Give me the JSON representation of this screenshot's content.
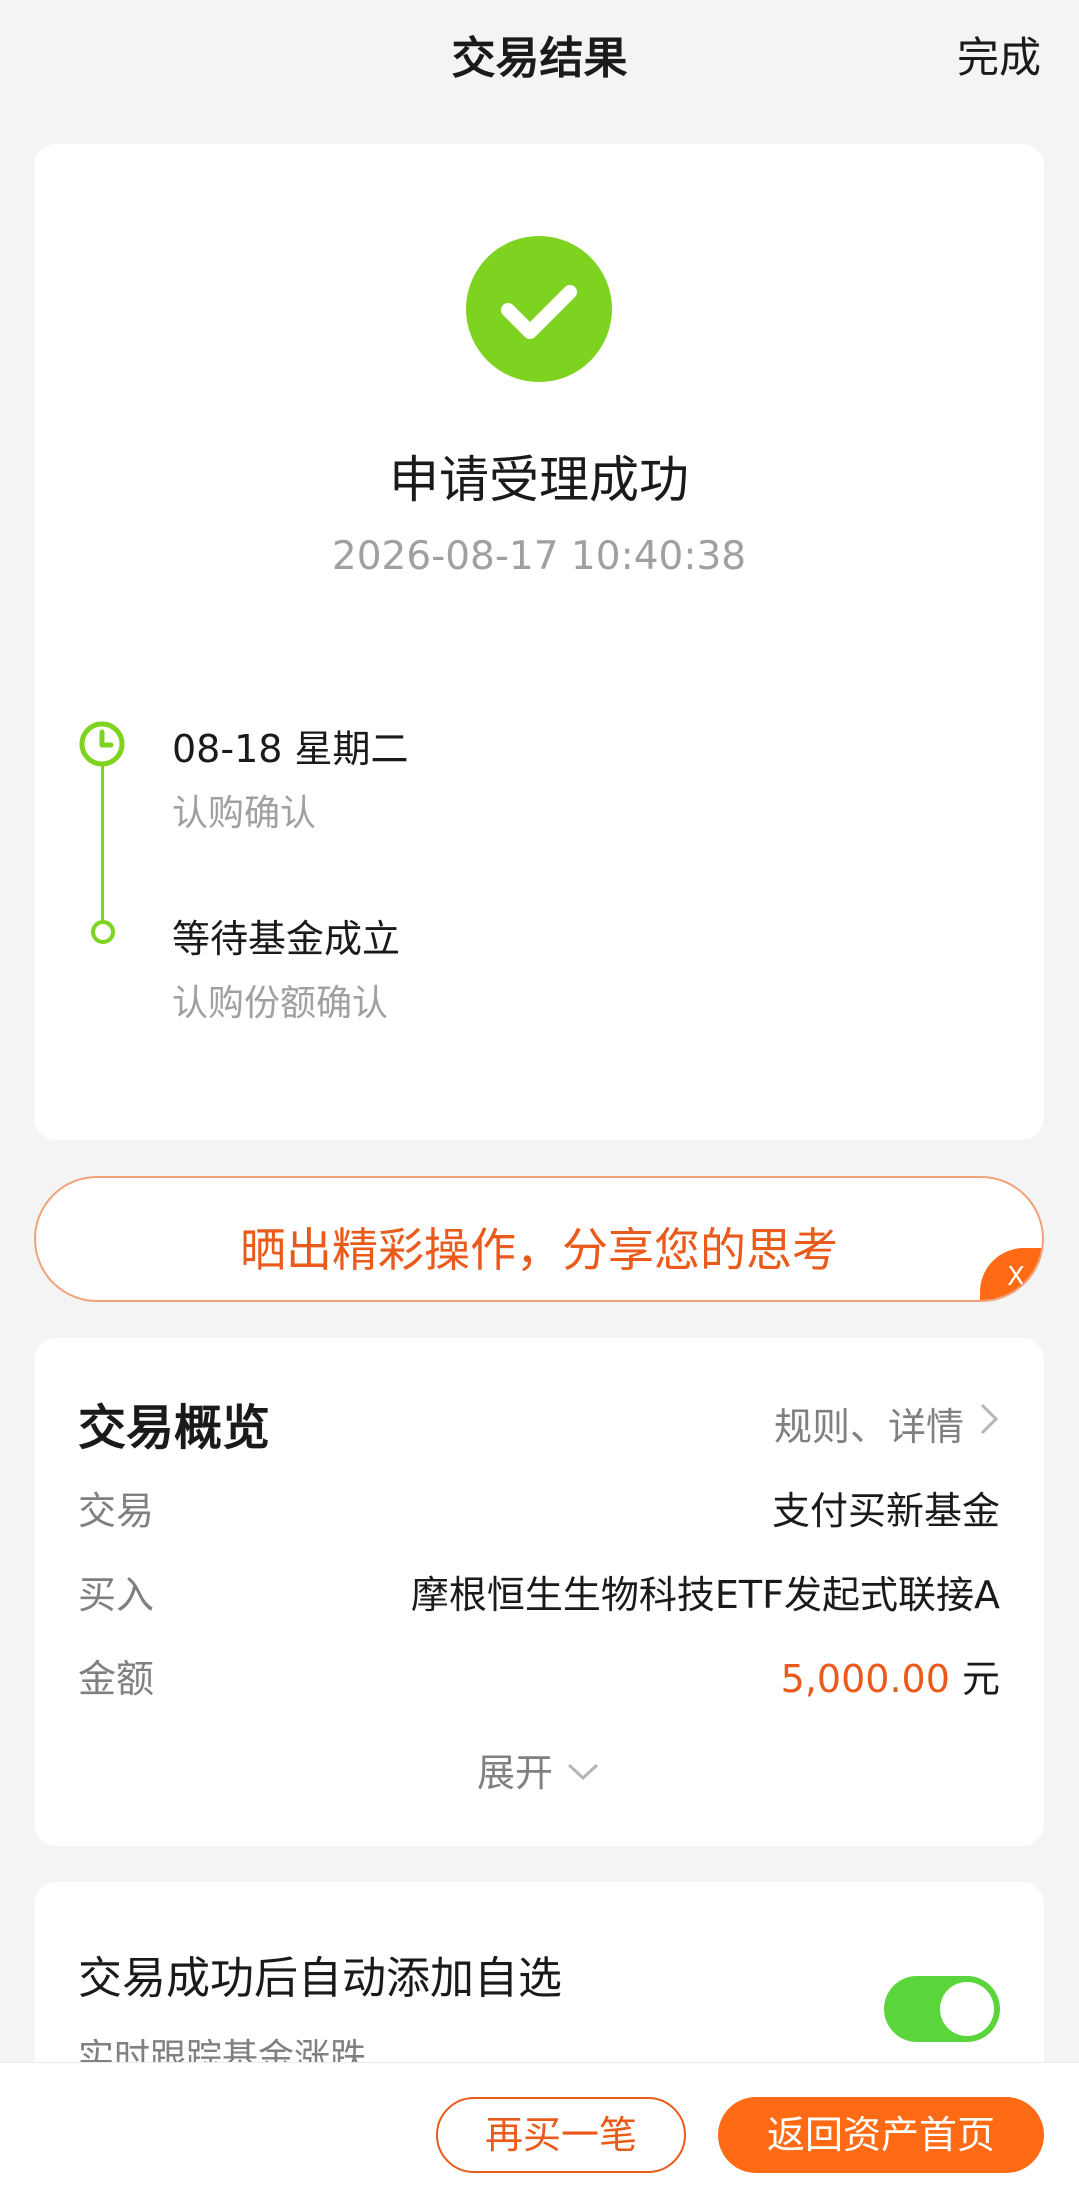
{
  "nav": {
    "title": "交易结果",
    "done_label": "完成"
  },
  "result": {
    "status_title": "申请受理成功",
    "timestamp": "2026-08-17 10:40:38",
    "success_color": "#7ed321",
    "timeline": [
      {
        "title": "08-18  星期二",
        "subtitle": "认购确认",
        "icon": "clock-icon"
      },
      {
        "title": "等待基金成立",
        "subtitle": "认购份额确认",
        "icon": "dot-icon"
      }
    ]
  },
  "share_banner": {
    "text": "晒出精彩操作，分享您的思考",
    "close_label": "X"
  },
  "overview": {
    "title": "交易概览",
    "link_label": "规则、详情",
    "rows": [
      {
        "label": "交易",
        "value": "支付买新基金"
      },
      {
        "label": "买入",
        "value": "摩根恒生生物科技ETF发起式联接A"
      },
      {
        "label": "金额",
        "amount": "5,000.00",
        "unit": "元"
      }
    ],
    "expand_label": "展开"
  },
  "auto_watch": {
    "title": "交易成功后自动添加自选",
    "subtitle": "实时跟踪基金涨跌",
    "toggle_on": true
  },
  "bottom_bar": {
    "buy_again_label": "再买一笔",
    "home_label": "返回资产首页"
  },
  "colors": {
    "accent": "#ff6a14",
    "accent_text": "#ea5a1a",
    "toggle": "#5bd53c"
  }
}
